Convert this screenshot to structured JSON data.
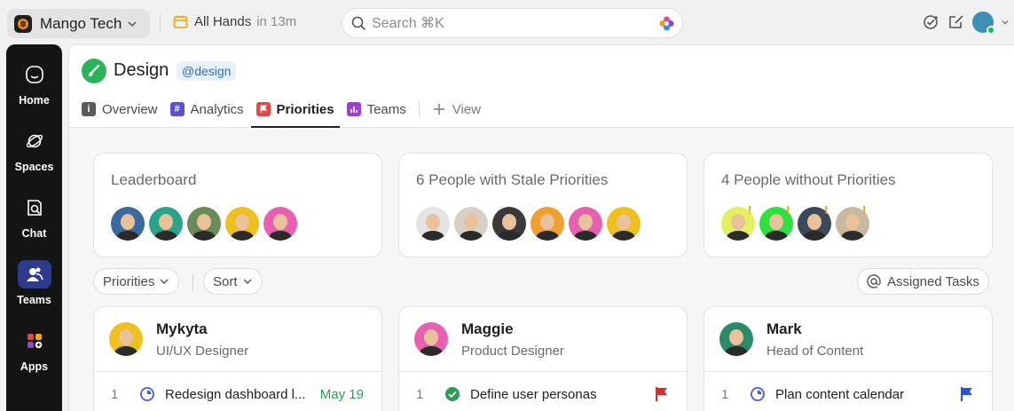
{
  "workspace": {
    "name": "Mango Tech"
  },
  "event": {
    "title": "All Hands",
    "time": "in 13m"
  },
  "search": {
    "placeholder": "Search ⌘K"
  },
  "rail": {
    "items": [
      {
        "label": "Home",
        "icon": "home-icon"
      },
      {
        "label": "Spaces",
        "icon": "planet-icon"
      },
      {
        "label": "Chat",
        "icon": "chat-icon"
      },
      {
        "label": "Teams",
        "icon": "teams-icon",
        "active": true
      },
      {
        "label": "Apps",
        "icon": "apps-icon"
      }
    ]
  },
  "space": {
    "title": "Design",
    "handle": "@design",
    "color": "#2bb35a"
  },
  "tabs": [
    {
      "label": "Overview",
      "icon": "info-icon",
      "color": "#5a5a5a"
    },
    {
      "label": "Analytics",
      "icon": "hash-icon",
      "color": "#5b4fd6"
    },
    {
      "label": "Priorities",
      "icon": "flag-icon",
      "color": "#e54848",
      "active": true
    },
    {
      "label": "Teams",
      "icon": "bar-chart-icon",
      "color": "#9b3fd6"
    }
  ],
  "add_view": {
    "label": "View"
  },
  "summaries": [
    {
      "title": "Leaderboard"
    },
    {
      "title": "6 People with Stale Priorities"
    },
    {
      "title": "4 People without Priorities"
    }
  ],
  "filters": {
    "priorities": "Priorities",
    "sort": "Sort",
    "assigned": "Assigned Tasks"
  },
  "people": [
    {
      "name": "Mykyta",
      "role": "UI/UX Designer",
      "task_num": "1",
      "task": "Redesign dashboard l...",
      "date": "May 19",
      "status": "in-progress"
    },
    {
      "name": "Maggie",
      "role": "Product Designer",
      "task_num": "1",
      "task": "Define user personas",
      "status": "done",
      "flag_color": "#d92b2b"
    },
    {
      "name": "Mark",
      "role": "Head of Content",
      "task_num": "1",
      "task": "Plan content calendar",
      "status": "in-progress",
      "flag_color": "#2b55d9"
    }
  ]
}
